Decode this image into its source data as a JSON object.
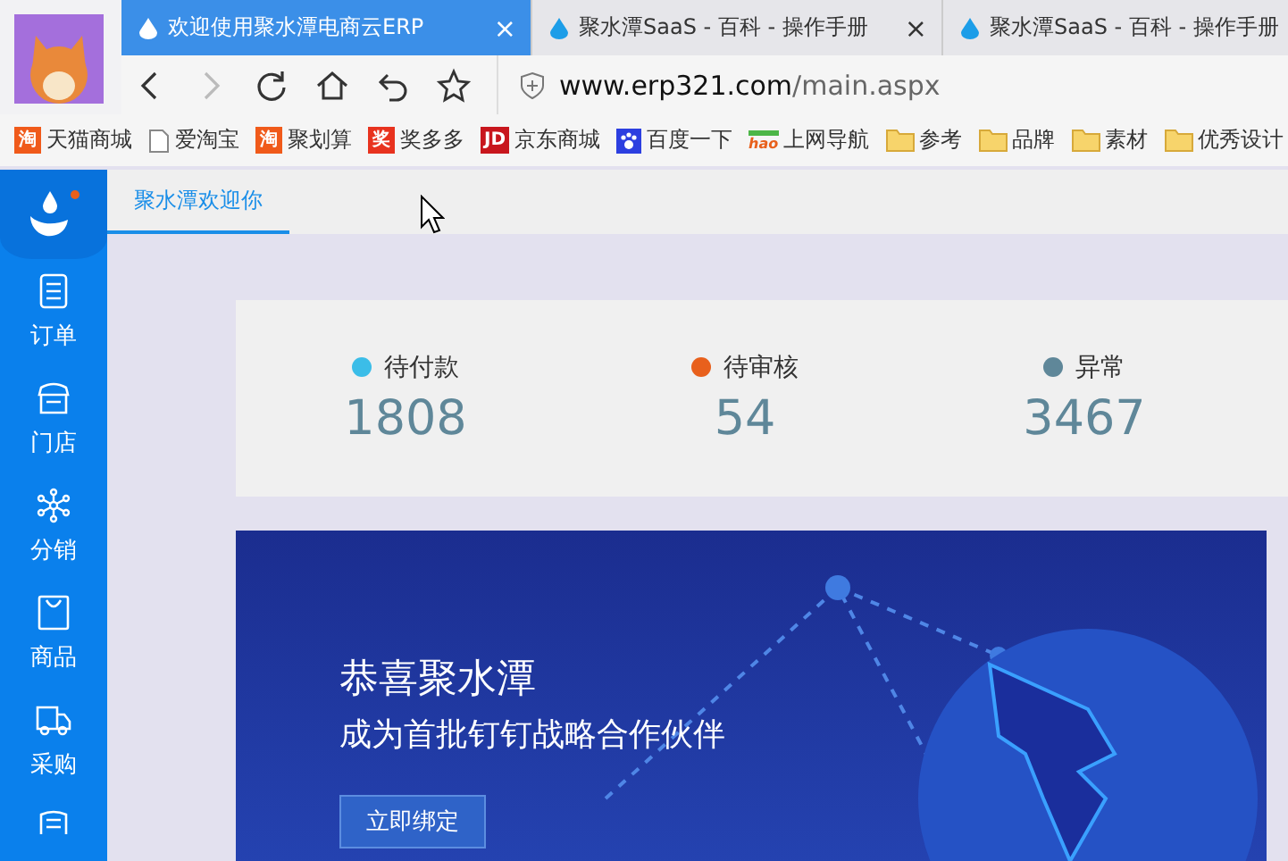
{
  "browser": {
    "tabs": [
      {
        "title": "欢迎使用聚水潭电商云ERP",
        "selected": true,
        "close": "×"
      },
      {
        "title": "聚水潭SaaS - 百科 - 操作手册",
        "selected": false,
        "close": "×"
      },
      {
        "title": "聚水潭SaaS - 百科 - 操作手册",
        "selected": false
      }
    ],
    "address": {
      "host": "www.erp321.com",
      "path": "/main.aspx"
    },
    "bookmarks": [
      {
        "label": "天猫商城",
        "kind": "badge",
        "badge": "淘",
        "color": "#f05a1a"
      },
      {
        "label": "爱淘宝",
        "kind": "page"
      },
      {
        "label": "聚划算",
        "kind": "badge",
        "badge": "淘",
        "color": "#f05a1a"
      },
      {
        "label": "奖多多",
        "kind": "badge",
        "badge": "奖",
        "color": "#e8321e"
      },
      {
        "label": "京东商城",
        "kind": "badge",
        "badge": "JD",
        "color": "#c8161d"
      },
      {
        "label": "百度一下",
        "kind": "paw"
      },
      {
        "label": "上网导航",
        "kind": "hao",
        "badge": "hao"
      },
      {
        "label": "参考",
        "kind": "folder"
      },
      {
        "label": "品牌",
        "kind": "folder"
      },
      {
        "label": "素材",
        "kind": "folder"
      },
      {
        "label": "优秀设计",
        "kind": "folder"
      }
    ]
  },
  "sidebar": {
    "items": [
      {
        "label": "订单",
        "kind": "list"
      },
      {
        "label": "门店",
        "kind": "store"
      },
      {
        "label": "分销",
        "kind": "network"
      },
      {
        "label": "商品",
        "kind": "bag"
      },
      {
        "label": "采购",
        "kind": "truck"
      }
    ]
  },
  "page_tabs": [
    {
      "label": "聚水潭欢迎你",
      "selected": true
    }
  ],
  "stats": [
    {
      "label": "待付款",
      "value": "1808",
      "color": "#3bbde8"
    },
    {
      "label": "待审核",
      "value": "54",
      "color": "#e8601c"
    },
    {
      "label": "异常",
      "value": "3467",
      "color": "#5f8799"
    }
  ],
  "banner": {
    "title": "恭喜聚水潭",
    "subtitle": "成为首批钉钉战略合作伙伴",
    "button": "立即绑定"
  }
}
